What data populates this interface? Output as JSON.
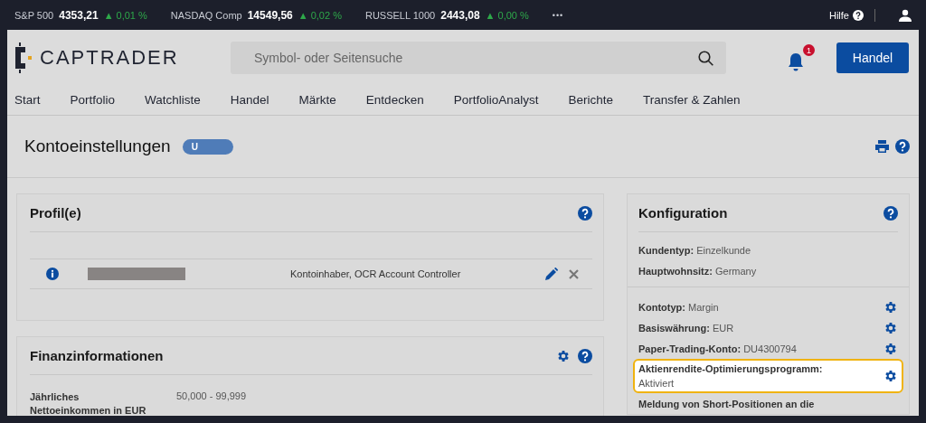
{
  "ticker": [
    {
      "name": "S&P 500",
      "value": "4353,21",
      "change": "▲ 0,01 %"
    },
    {
      "name": "NASDAQ Comp",
      "value": "14549,56",
      "change": "▲ 0,02 %"
    },
    {
      "name": "RUSSELL 1000",
      "value": "2443,08",
      "change": "▲ 0,00 %"
    }
  ],
  "ticker_more": "•••",
  "help_link": "Hilfe",
  "logo": "CAPTRADER",
  "search": {
    "placeholder": "Symbol- oder Seitensuche"
  },
  "notifications": {
    "count": "1"
  },
  "trade_button": "Handel",
  "nav": [
    {
      "label": "Start",
      "selected": false
    },
    {
      "label": "Portfolio",
      "selected": false
    },
    {
      "label": "Watchliste",
      "selected": false
    },
    {
      "label": "Handel",
      "selected": false
    },
    {
      "label": "Märkte",
      "selected": false
    },
    {
      "label": "Entdecken",
      "selected": false
    },
    {
      "label": "PortfolioAnalyst",
      "selected": false
    },
    {
      "label": "Berichte",
      "selected": false
    },
    {
      "label": "Transfer & Zahlen",
      "selected": false
    }
  ],
  "page_title": "Kontoeinstellungen",
  "account_badge": "U",
  "profiles": {
    "title": "Profil(e)",
    "rows": [
      {
        "roles": "Kontoinhaber, OCR Account Controller"
      }
    ]
  },
  "finance": {
    "title": "Finanzinformationen",
    "rows": [
      {
        "label": "Jährliches Nettoeinkommen in EUR",
        "value": "50,000 - 99,999"
      }
    ]
  },
  "configuration": {
    "title": "Konfiguration",
    "sections": [
      {
        "rows": [
          {
            "kind": "info",
            "label": "Kundentyp:",
            "value": "Einzelkunde",
            "highlighted": false
          },
          {
            "kind": "info",
            "label": "Hauptwohnsitz:",
            "value": "Germany",
            "highlighted": false
          }
        ]
      },
      {
        "rows": [
          {
            "kind": "editable",
            "label": "Kontotyp:",
            "value": "Margin",
            "highlighted": false
          },
          {
            "kind": "editable",
            "label": "Basiswährung:",
            "value": "EUR",
            "highlighted": false
          },
          {
            "kind": "editable",
            "label": "Paper-Trading-Konto:",
            "value": "DU4300794",
            "highlighted": false
          },
          {
            "kind": "editable",
            "label": "Aktienrendite-Optimierungsprogramm:",
            "value": "Aktiviert",
            "highlighted": true
          },
          {
            "kind": "info",
            "label": "Meldung von Short-Positionen an die",
            "highlighted": false
          }
        ]
      }
    ]
  }
}
